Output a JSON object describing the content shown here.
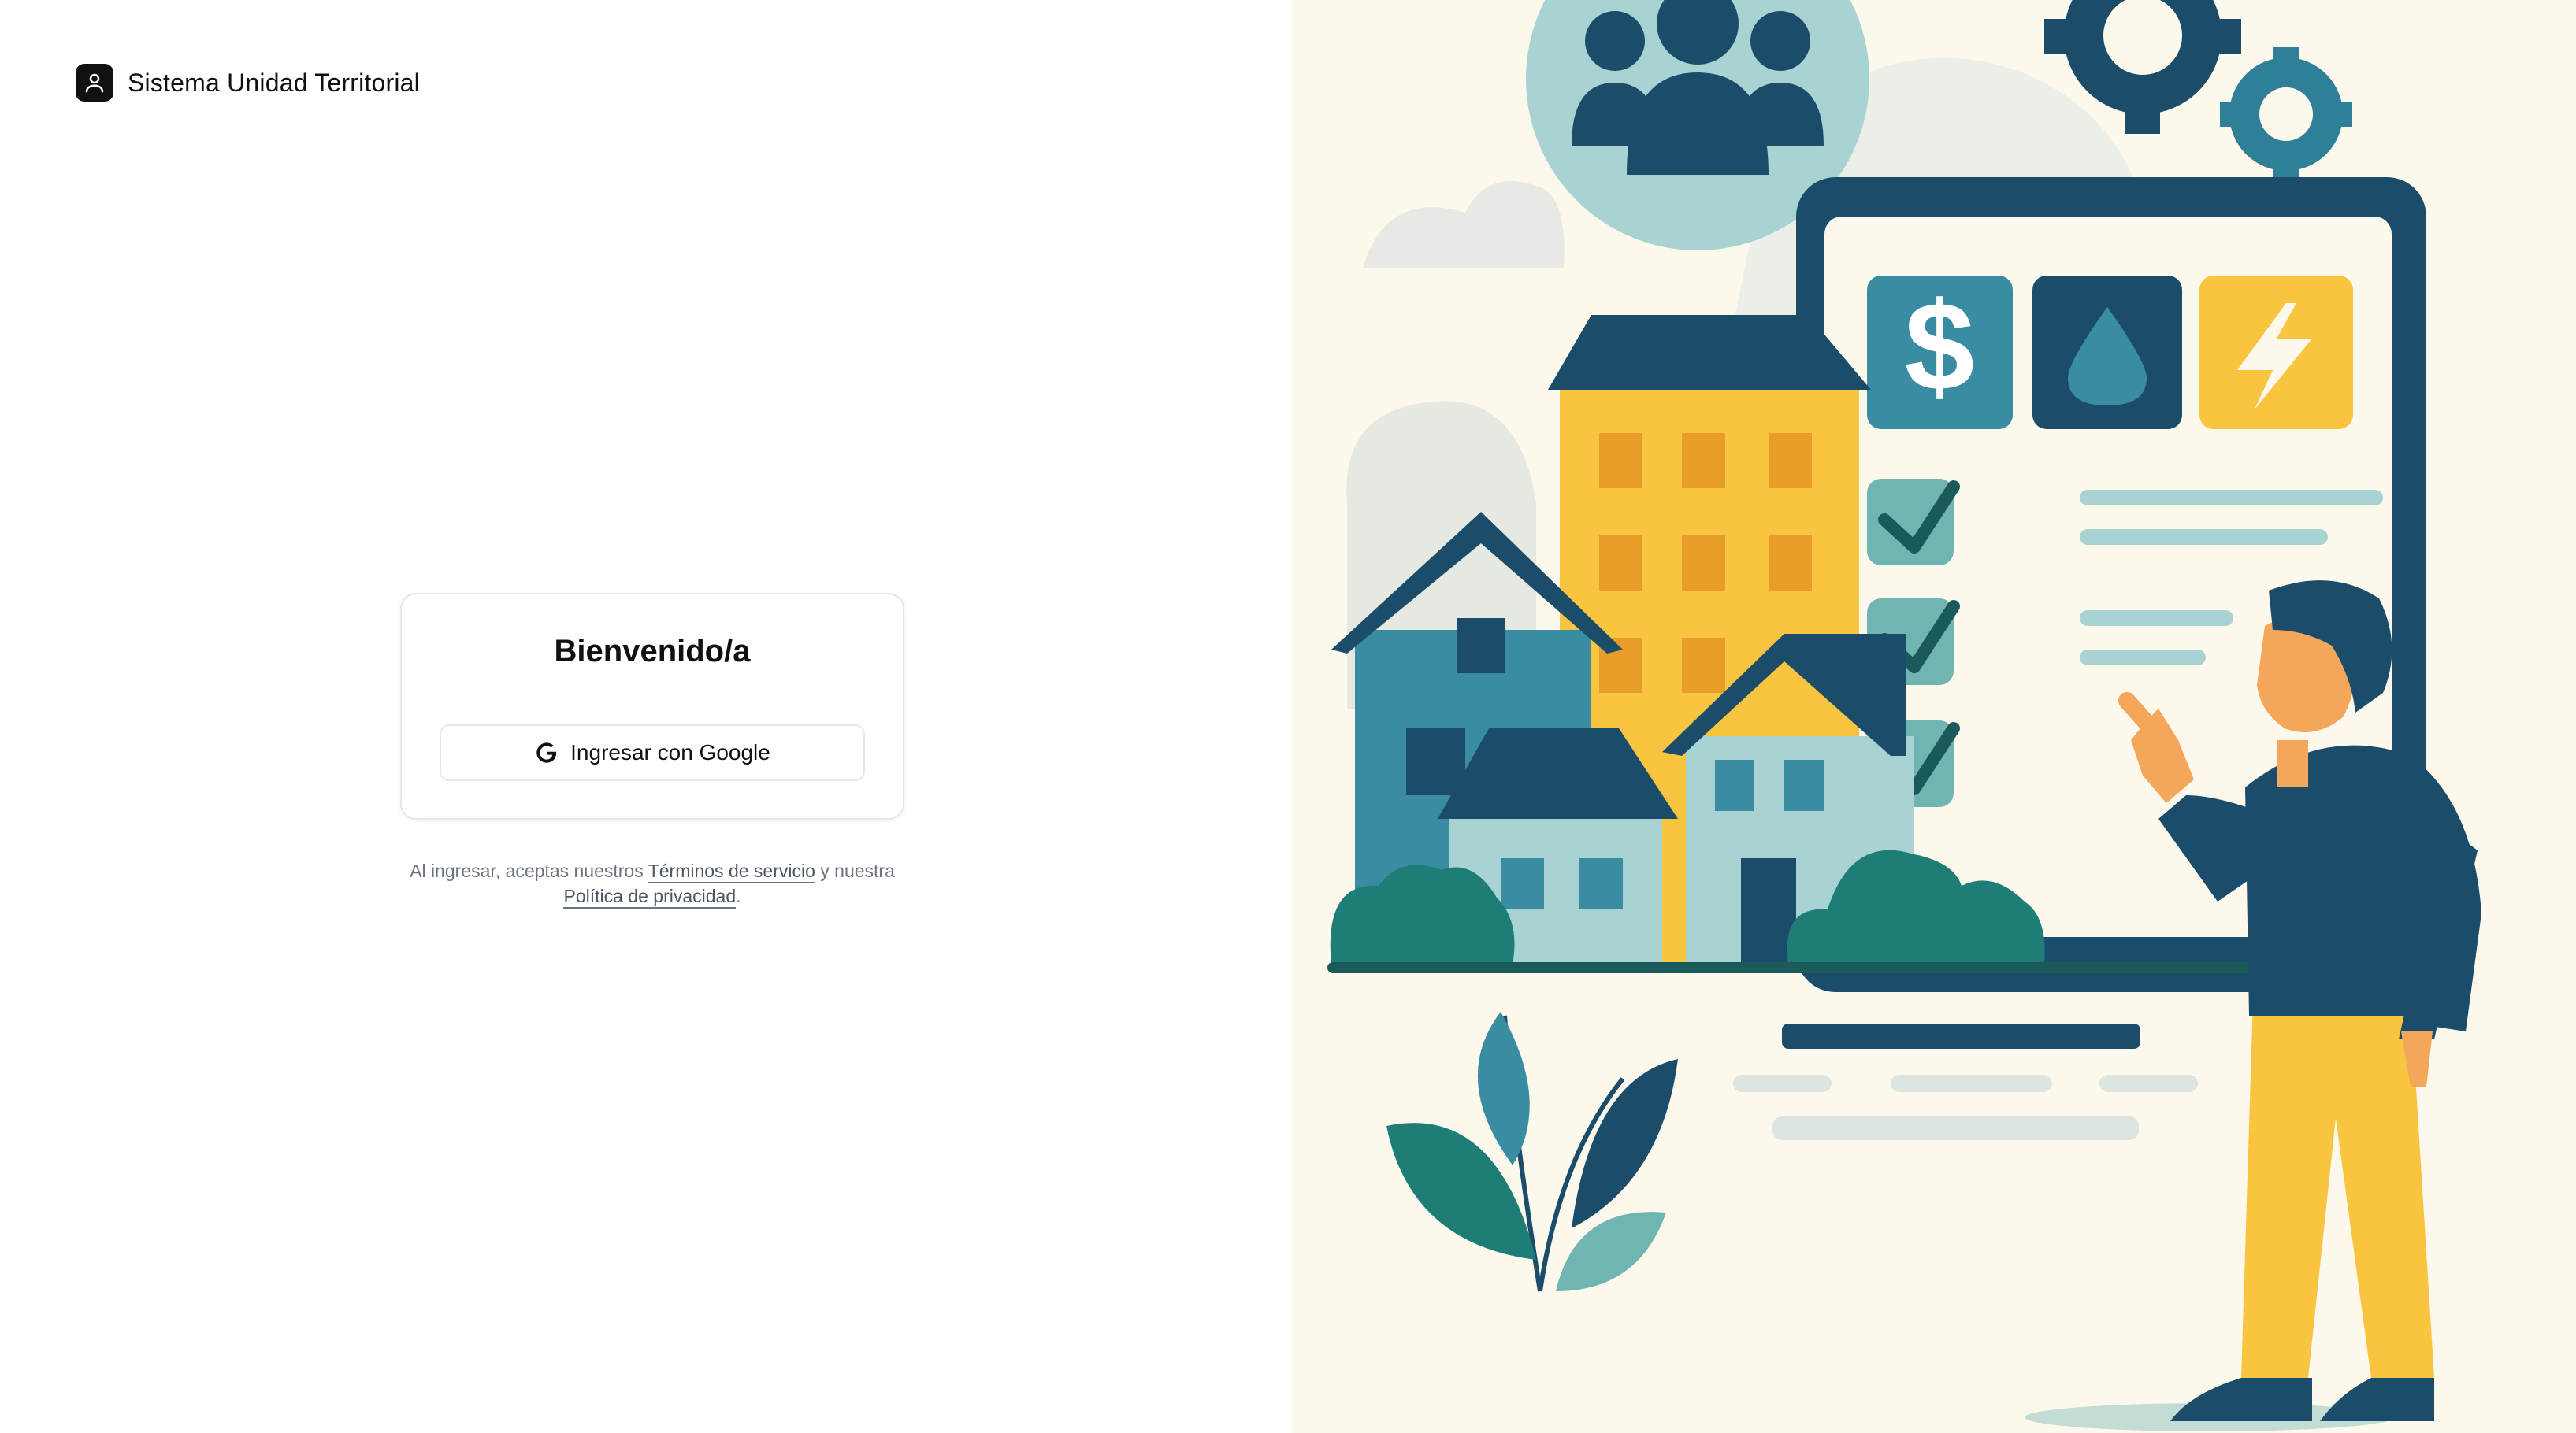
{
  "brand": {
    "name": "Sistema Unidad Territorial",
    "logo_icon": "user-icon"
  },
  "login_card": {
    "title": "Bienvenido/a",
    "google_button_label": "Ingresar con Google",
    "google_icon": "google-icon"
  },
  "legal": {
    "prefix": "Al ingresar, aceptas nuestros",
    "terms_link": "Términos de servicio",
    "middle": "y nuestra",
    "privacy_link": "Política de privacidad",
    "suffix": "."
  },
  "illustration": {
    "icons": [
      "community-icon",
      "gear-icon",
      "dollar-icon",
      "water-drop-icon",
      "lightning-icon",
      "checkmark-icon"
    ],
    "colors": {
      "background": "#fdf8ec",
      "navy": "#1b4d6b",
      "teal": "#3a8ca3",
      "yellow": "#f9c440",
      "light_teal": "#a9d3d3"
    }
  }
}
